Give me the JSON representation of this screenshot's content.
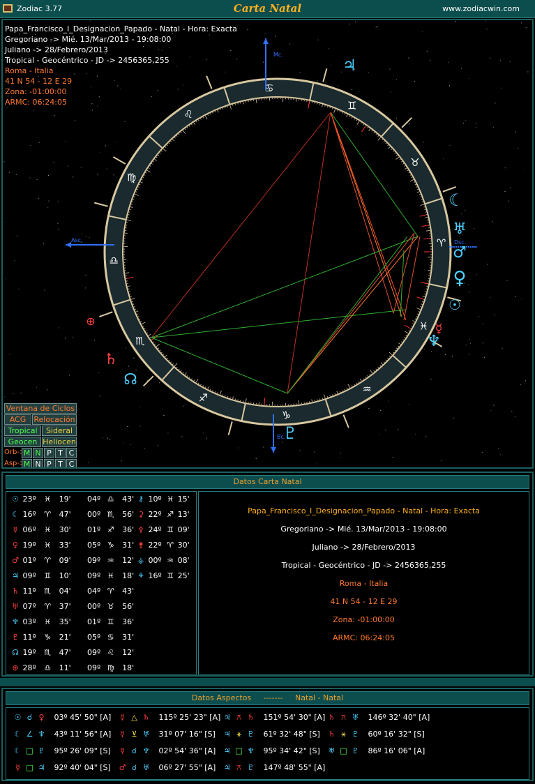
{
  "app": {
    "name": "Zodiac 3.77",
    "title": "Carta Natal",
    "url": "www.zodiacwin.com"
  },
  "info_lines": [
    "Papa_Francisco_I_Designacion_Papado - Natal - Hora: Exacta",
    "Gregoriano -> Mié. 13/Mar/2013 - 19:08:00",
    "Juliano -> 28/Febrero/2013",
    "Tropical - Geocéntrico - JD -> 2456365,255",
    "Roma - Italia",
    "41 N 54 - 12 E 29",
    "Zona: -01:00:00",
    "ARMC: 06:24:05"
  ],
  "axis_labels": {
    "mc": "Mc.",
    "asc": "Asc.",
    "dsc": "Dsc.",
    "ic": "Bc."
  },
  "buttons": {
    "ventana": "Ventana de Ciclos",
    "acg": "ACG",
    "relocacion": "Relocación",
    "tropical": "Tropical",
    "sideral": "Sideral",
    "geocen": "Geocen",
    "heliocen": "Heliocen",
    "orb_label": "Orb->",
    "asp_label": "Asp->",
    "toggles": [
      "M",
      "N",
      "P",
      "T",
      "C"
    ]
  },
  "natal_panel": {
    "title": "Datos Carta Natal",
    "planets": [
      {
        "glyph": "☉",
        "color": "#4dd0ff",
        "deg": "23º",
        "sign": "♓",
        "min": "19'"
      },
      {
        "glyph": "☾",
        "color": "#4dd0ff",
        "deg": "16º",
        "sign": "♈",
        "min": "47'"
      },
      {
        "glyph": "☿",
        "color": "#ff4040",
        "deg": "06º",
        "sign": "♓",
        "min": "30'"
      },
      {
        "glyph": "♀",
        "color": "#ff4040",
        "deg": "19º",
        "sign": "♓",
        "min": "33'"
      },
      {
        "glyph": "♂",
        "color": "#ff4040",
        "deg": "01º",
        "sign": "♈",
        "min": "09'"
      },
      {
        "glyph": "♃",
        "color": "#4dd0ff",
        "deg": "09º",
        "sign": "♊",
        "min": "10'"
      },
      {
        "glyph": "♄",
        "color": "#ff4040",
        "deg": "11º",
        "sign": "♏",
        "min": "04'"
      },
      {
        "glyph": "♅",
        "color": "#ff4040",
        "deg": "07º",
        "sign": "♈",
        "min": "37'"
      },
      {
        "glyph": "♆",
        "color": "#4dd0ff",
        "deg": "03º",
        "sign": "♓",
        "min": "35'"
      },
      {
        "glyph": "♇",
        "color": "#ff4040",
        "deg": "11º",
        "sign": "♑",
        "min": "21'"
      },
      {
        "glyph": "☊",
        "color": "#4dd0ff",
        "deg": "19º",
        "sign": "♏",
        "min": "47'"
      },
      {
        "glyph": "⊕",
        "color": "#ff4040",
        "deg": "28º",
        "sign": "♎",
        "min": "11'"
      }
    ],
    "houses": [
      {
        "deg": "04º",
        "sign": "♎",
        "min": "43'"
      },
      {
        "deg": "00º",
        "sign": "♏",
        "min": "56'"
      },
      {
        "deg": "01º",
        "sign": "♐",
        "min": "36'"
      },
      {
        "deg": "05º",
        "sign": "♑",
        "min": "31'"
      },
      {
        "deg": "09º",
        "sign": "♒",
        "min": "12'"
      },
      {
        "deg": "09º",
        "sign": "♓",
        "min": "18'"
      },
      {
        "deg": "04º",
        "sign": "♈",
        "min": "43'"
      },
      {
        "deg": "00º",
        "sign": "♉",
        "min": "56'"
      },
      {
        "deg": "01º",
        "sign": "♊",
        "min": "36'"
      },
      {
        "deg": "05º",
        "sign": "♋",
        "min": "31'"
      },
      {
        "deg": "09º",
        "sign": "♌",
        "min": "12'"
      },
      {
        "deg": "09º",
        "sign": "♍",
        "min": "18'"
      }
    ],
    "asteroids": [
      {
        "glyph": "⚷",
        "color": "#4dd0ff",
        "deg": "10º",
        "sign": "♓",
        "min": "15'"
      },
      {
        "glyph": "⚳",
        "color": "#ff4040",
        "deg": "22º",
        "sign": "♐",
        "min": "13'"
      },
      {
        "glyph": "⚴",
        "color": "#ff4040",
        "deg": "24º",
        "sign": "♊",
        "min": "09'"
      },
      {
        "glyph": "⚵",
        "color": "#ff4040",
        "deg": "22º",
        "sign": "♈",
        "min": "30'"
      },
      {
        "glyph": "⚶",
        "color": "#4dd0ff",
        "deg": "00º",
        "sign": "♒",
        "min": "08'"
      },
      {
        "glyph": "⚘",
        "color": "#4dd0ff",
        "deg": "16º",
        "sign": "♊",
        "min": "25'"
      }
    ],
    "summary_lines": [
      "Papa_Francisco_I_Designacion_Papado - Natal - Hora: Exacta",
      "Gregoriano -> Mié. 13/Mar/2013 - 19:08:00",
      "Juliano -> 28/Febrero/2013",
      "Tropical - Geocéntrico - JD -> 2456365,255",
      "Roma - Italia",
      "41 N 54 - 12 E 29",
      "Zona: -01:00:00",
      "ARMC: 06:24:05"
    ]
  },
  "aspects_panel": {
    "title": "Datos Aspectos",
    "sep": "-------",
    "subtitle": "Natal - Natal",
    "aspects": [
      {
        "p1": "☉",
        "c1": "#4dd0ff",
        "a": "☌",
        "ca": "#4dd0ff",
        "p2": "♀",
        "c2": "#ff4040",
        "val": "03º 45' 50\" [A]"
      },
      {
        "p1": "☾",
        "c1": "#4dd0ff",
        "a": "∠",
        "ca": "#4dd0ff",
        "p2": "♆",
        "c2": "#4dd0ff",
        "val": "43º 11' 56\" [A]"
      },
      {
        "p1": "☾",
        "c1": "#4dd0ff",
        "a": "□",
        "ca": "#4dff4d",
        "p2": "♇",
        "c2": "#4dd0ff",
        "val": "95º 26' 09\" [S]"
      },
      {
        "p1": "☿",
        "c1": "#ff4040",
        "a": "□",
        "ca": "#4dff4d",
        "p2": "♃",
        "c2": "#4dd0ff",
        "val": "92º 40' 04\" [S]"
      },
      {
        "p1": "☿",
        "c1": "#ff4040",
        "a": "△",
        "ca": "#ffe040",
        "p2": "♄",
        "c2": "#ff4040",
        "val": "115º 25' 23\" [A]"
      },
      {
        "p1": "☿",
        "c1": "#ff4040",
        "a": "⊻",
        "ca": "#ffe040",
        "p2": "♅",
        "c2": "#4dd0ff",
        "val": "31º 07' 16\" [S]"
      },
      {
        "p1": "☿",
        "c1": "#ff4040",
        "a": "☌",
        "ca": "#4dd0ff",
        "p2": "♆",
        "c2": "#4dd0ff",
        "val": "02º 54' 36\" [A]"
      },
      {
        "p1": "♂",
        "c1": "#ff4040",
        "a": "☌",
        "ca": "#4dd0ff",
        "p2": "♅",
        "c2": "#4dd0ff",
        "val": "06º 27' 55\" [A]"
      },
      {
        "p1": "♃",
        "c1": "#4dd0ff",
        "a": "⚻",
        "ca": "#ff4040",
        "p2": "♄",
        "c2": "#ff4040",
        "val": "151º 54' 30\" [A]"
      },
      {
        "p1": "♃",
        "c1": "#4dd0ff",
        "a": "⚹",
        "ca": "#ffe040",
        "p2": "♇",
        "c2": "#4dd0ff",
        "val": "61º 32' 48\" [S]"
      },
      {
        "p1": "♃",
        "c1": "#4dd0ff",
        "a": "□",
        "ca": "#4dff4d",
        "p2": "♆",
        "c2": "#4dd0ff",
        "val": "95º 34' 42\" [S]"
      },
      {
        "p1": "♃",
        "c1": "#4dd0ff",
        "a": "⚻",
        "ca": "#ff4040",
        "p2": "♇",
        "c2": "#4dd0ff",
        "val": "147º 48' 55\" [A]"
      },
      {
        "p1": "♄",
        "c1": "#ff4040",
        "a": "⚻",
        "ca": "#ff4040",
        "p2": "♅",
        "c2": "#4dd0ff",
        "val": "146º 32' 40\" [A]"
      },
      {
        "p1": "♄",
        "c1": "#ff4040",
        "a": "⚹",
        "ca": "#ffe040",
        "p2": "♇",
        "c2": "#4dd0ff",
        "val": "60º 16' 32\" [S]"
      },
      {
        "p1": "♅",
        "c1": "#4dd0ff",
        "a": "□",
        "ca": "#4dff4d",
        "p2": "♇",
        "c2": "#4dd0ff",
        "val": "86º 16' 06\" [A]"
      }
    ]
  },
  "wheel": {
    "signs": [
      "♈",
      "♉",
      "♊",
      "♋",
      "♌",
      "♍",
      "♎",
      "♏",
      "♐",
      "♑",
      "♒",
      "♓"
    ],
    "chart_planets": [
      {
        "glyph": "♃",
        "color": "#4dd0ff"
      },
      {
        "glyph": "☾",
        "color": "#4dd0ff"
      },
      {
        "glyph": "♅",
        "color": "#4dd0ff"
      },
      {
        "glyph": "♂",
        "color": "#4dd0ff"
      },
      {
        "glyph": "♀",
        "color": "#4dd0ff"
      },
      {
        "glyph": "♆",
        "color": "#4dd0ff"
      },
      {
        "glyph": "☿",
        "color": "#ff4040"
      },
      {
        "glyph": "♇",
        "color": "#4dd0ff"
      },
      {
        "glyph": "♄",
        "color": "#ff4040"
      },
      {
        "glyph": "☊",
        "color": "#4dd0ff"
      },
      {
        "glyph": "⊕",
        "color": "#ff4040"
      },
      {
        "glyph": "☉",
        "color": "#4dd0ff"
      }
    ]
  }
}
